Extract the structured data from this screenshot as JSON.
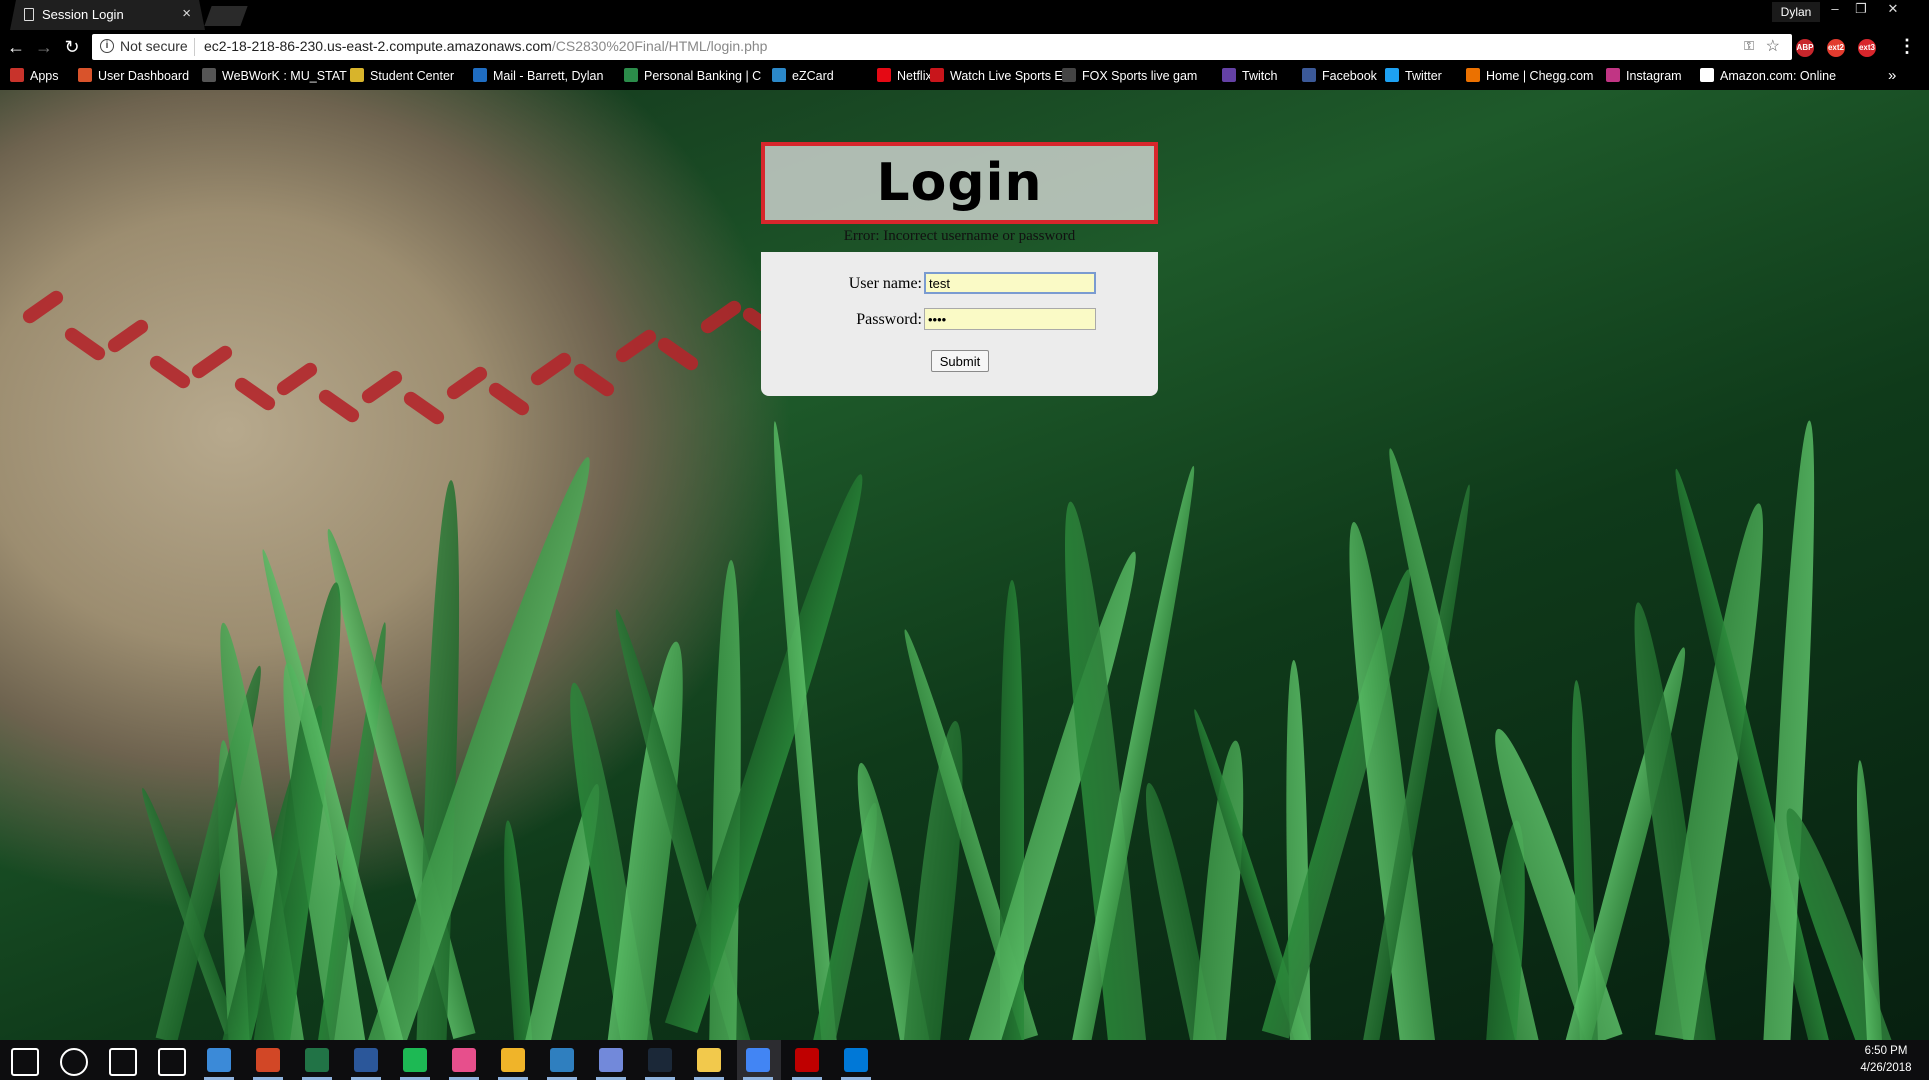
{
  "browser": {
    "tab_title": "Session Login",
    "tab_close": "×",
    "profile_name": "Dylan",
    "window_controls": [
      "–",
      "❐",
      "✕"
    ],
    "security_label": "Not secure",
    "url_host": "ec2-18-218-86-230.us-east-2.compute.amazonaws.com",
    "url_path": "/CS2830%20Final/HTML/login.php",
    "extensions": [
      {
        "name": "ABP",
        "color": "#c8262c"
      },
      {
        "name": "ext2",
        "color": "#e23b2e"
      },
      {
        "name": "ext3",
        "color": "#d8262c"
      }
    ]
  },
  "bookmarks": [
    {
      "label": "Apps",
      "icon": "apps-grid-icon",
      "color": "#c8332b"
    },
    {
      "label": "User Dashboard",
      "icon": "dashboard-icon",
      "color": "#d9532b"
    },
    {
      "label": "WeBWorK : MU_STAT",
      "icon": "page-icon",
      "color": "#555555"
    },
    {
      "label": "Student Center",
      "icon": "student-center-icon",
      "color": "#d8b42b"
    },
    {
      "label": "Mail - Barrett, Dylan",
      "icon": "outlook-icon",
      "color": "#1f6dc2"
    },
    {
      "label": "Personal Banking | C",
      "icon": "bank-icon",
      "color": "#2b8c4a"
    },
    {
      "label": "eZCard",
      "icon": "ezcard-icon",
      "color": "#2b88c8"
    },
    {
      "label": "Netflix",
      "icon": "netflix-icon",
      "color": "#e50914"
    },
    {
      "label": "Watch Live Sports Ev",
      "icon": "sports-icon",
      "color": "#c8151b"
    },
    {
      "label": "FOX Sports live gam",
      "icon": "fox-icon",
      "color": "#444444"
    },
    {
      "label": "Twitch",
      "icon": "twitch-icon",
      "color": "#6441a5"
    },
    {
      "label": "Facebook",
      "icon": "facebook-icon",
      "color": "#3b5998"
    },
    {
      "label": "Twitter",
      "icon": "twitter-icon",
      "color": "#1da1f2"
    },
    {
      "label": "Home | Chegg.com",
      "icon": "chegg-icon",
      "color": "#eb7100"
    },
    {
      "label": "Instagram",
      "icon": "instagram-icon",
      "color": "#c13584"
    },
    {
      "label": "Amazon.com: Online",
      "icon": "amazon-icon",
      "color": "#ffffff"
    }
  ],
  "login": {
    "title": "Login",
    "error": "Error: Incorrect username or password",
    "username_label": "User name:",
    "username_value": "test",
    "password_label": "Password:",
    "password_value": "••••",
    "submit_label": "Submit"
  },
  "taskbar": {
    "apps": [
      {
        "name": "start-icon",
        "color": "#ffffff"
      },
      {
        "name": "cortana-icon",
        "color": "#ffffff"
      },
      {
        "name": "task-view-icon",
        "color": "#ffffff"
      },
      {
        "name": "settings-icon",
        "color": "#ffffff"
      },
      {
        "name": "explorer-blue-icon",
        "color": "#3b8ad8"
      },
      {
        "name": "powerpoint-icon",
        "color": "#d24726"
      },
      {
        "name": "excel-icon",
        "color": "#217346"
      },
      {
        "name": "word-icon",
        "color": "#2b579a"
      },
      {
        "name": "spotify-icon",
        "color": "#1db954"
      },
      {
        "name": "itunes-icon",
        "color": "#e74f8c"
      },
      {
        "name": "sticky-icon",
        "color": "#f0b429"
      },
      {
        "name": "app-icon",
        "color": "#2f7fbf"
      },
      {
        "name": "discord-icon",
        "color": "#7289da"
      },
      {
        "name": "steam-icon",
        "color": "#1b2838"
      },
      {
        "name": "file-explorer-icon",
        "color": "#f2c94c"
      },
      {
        "name": "chrome-icon",
        "color": "#4285f4"
      },
      {
        "name": "filezilla-icon",
        "color": "#bf0000"
      },
      {
        "name": "edge-icon",
        "color": "#0078d7"
      }
    ],
    "time": "6:50 PM",
    "date": "4/26/2018"
  }
}
